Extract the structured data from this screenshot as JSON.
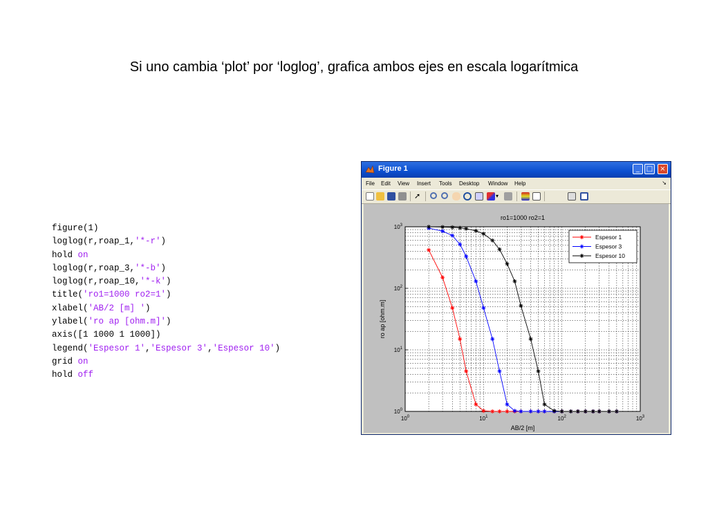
{
  "slide": {
    "title": "Si uno cambia ‘plot’ por ‘loglog’, grafica ambos ejes en escala logarítmica"
  },
  "code": {
    "lines": [
      [
        {
          "t": "figure(1)",
          "c": "plain"
        }
      ],
      [
        {
          "t": "loglog(r,roap_1,",
          "c": "plain"
        },
        {
          "t": "'*-r'",
          "c": "str"
        },
        {
          "t": ")",
          "c": "plain"
        }
      ],
      [
        {
          "t": "hold ",
          "c": "plain"
        },
        {
          "t": "on",
          "c": "kw"
        }
      ],
      [
        {
          "t": "loglog(r,roap_3,",
          "c": "plain"
        },
        {
          "t": "'*-b'",
          "c": "str"
        },
        {
          "t": ")",
          "c": "plain"
        }
      ],
      [
        {
          "t": "loglog(r,roap_10,",
          "c": "plain"
        },
        {
          "t": "'*-k'",
          "c": "str"
        },
        {
          "t": ")",
          "c": "plain"
        }
      ],
      [
        {
          "t": "title(",
          "c": "plain"
        },
        {
          "t": "'ro1=1000 ro2=1'",
          "c": "str"
        },
        {
          "t": ")",
          "c": "plain"
        }
      ],
      [
        {
          "t": "xlabel(",
          "c": "plain"
        },
        {
          "t": "'AB/2 [m] '",
          "c": "str"
        },
        {
          "t": ")",
          "c": "plain"
        }
      ],
      [
        {
          "t": "ylabel(",
          "c": "plain"
        },
        {
          "t": "'ro ap [ohm.m]'",
          "c": "str"
        },
        {
          "t": ")",
          "c": "plain"
        }
      ],
      [
        {
          "t": "axis([1 1000 1 1000])",
          "c": "plain"
        }
      ],
      [
        {
          "t": "legend(",
          "c": "plain"
        },
        {
          "t": "'Espesor 1'",
          "c": "str"
        },
        {
          "t": ",",
          "c": "plain"
        },
        {
          "t": "'Espesor 3'",
          "c": "str"
        },
        {
          "t": ",",
          "c": "plain"
        },
        {
          "t": "'Espesor 10'",
          "c": "str"
        },
        {
          "t": ")",
          "c": "plain"
        }
      ],
      [
        {
          "t": "grid ",
          "c": "plain"
        },
        {
          "t": "on",
          "c": "kw"
        }
      ],
      [
        {
          "t": "hold ",
          "c": "plain"
        },
        {
          "t": "off",
          "c": "kw"
        }
      ]
    ]
  },
  "window": {
    "title": "Figure 1",
    "menu": [
      "File",
      "Edit",
      "View",
      "Insert",
      "Tools",
      "Desktop",
      "Window",
      "Help"
    ],
    "menu_arrow": "↘",
    "toolbar_icons": [
      "new-file-icon",
      "open-icon",
      "save-icon",
      "print-icon",
      "pointer-icon",
      "zoom-in-icon",
      "zoom-out-icon",
      "pan-icon",
      "rotate-icon",
      "data-cursor-icon",
      "brush-icon",
      "link-icon",
      "colorbar-icon",
      "legend-icon",
      "hide-tools-icon",
      "show-tools-icon"
    ],
    "buttons": {
      "minimize": "_",
      "maximize": "□",
      "close": "×"
    }
  },
  "chart_data": {
    "type": "line",
    "title": "ro1=1000 ro2=1",
    "xlabel": "AB/2 [m]",
    "ylabel": "ro ap [ohm.m]",
    "xscale": "log",
    "yscale": "log",
    "xlim": [
      1,
      1000
    ],
    "ylim": [
      1,
      1000
    ],
    "grid": true,
    "legend_position": "top-right",
    "x_ticks": [
      1,
      10,
      100,
      1000
    ],
    "y_ticks": [
      1,
      10,
      100,
      1000
    ],
    "series": [
      {
        "name": "Espesor 1",
        "color": "#ff0000",
        "x": [
          2,
          3,
          4,
          5,
          6,
          8,
          10,
          13,
          16,
          20,
          25,
          30,
          40,
          50,
          60,
          80,
          100,
          130,
          160,
          200,
          250,
          300,
          400,
          500
        ],
        "y": [
          420,
          150,
          48,
          15,
          4.5,
          1.3,
          1.02,
          1,
          1,
          1,
          1,
          1,
          1,
          1,
          1,
          1,
          1,
          1,
          1,
          1,
          1,
          1,
          1,
          1
        ]
      },
      {
        "name": "Espesor 3",
        "color": "#0000ff",
        "x": [
          2,
          3,
          4,
          5,
          6,
          8,
          10,
          13,
          16,
          20,
          25,
          30,
          40,
          50,
          60,
          80,
          100,
          130,
          160,
          200,
          250,
          300,
          400,
          500
        ],
        "y": [
          950,
          850,
          720,
          520,
          330,
          130,
          48,
          15,
          4.5,
          1.3,
          1.02,
          1,
          1,
          1,
          1,
          1,
          1,
          1,
          1,
          1,
          1,
          1,
          1,
          1
        ]
      },
      {
        "name": "Espesor 10",
        "color": "#000000",
        "x": [
          2,
          3,
          4,
          5,
          6,
          8,
          10,
          13,
          16,
          20,
          25,
          30,
          40,
          50,
          60,
          80,
          100,
          130,
          160,
          200,
          250,
          300,
          400,
          500
        ],
        "y": [
          1000,
          990,
          980,
          960,
          930,
          860,
          770,
          600,
          430,
          250,
          130,
          52,
          15,
          4.5,
          1.3,
          1.02,
          1,
          1,
          1,
          1,
          1,
          1,
          1,
          1
        ]
      }
    ]
  }
}
